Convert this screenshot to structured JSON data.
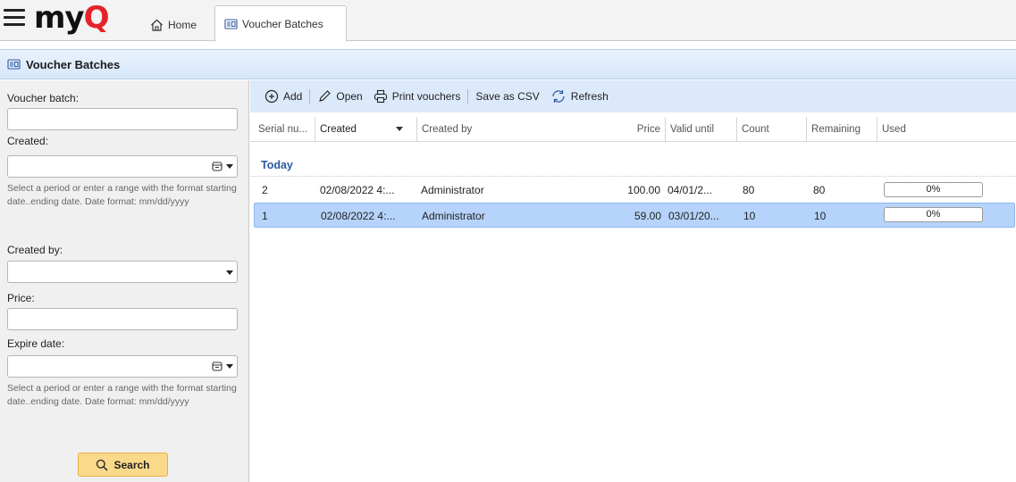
{
  "app": {
    "logo": {
      "part1": "my",
      "part2": "Q"
    },
    "tabs": [
      {
        "label": "Home",
        "icon": "home-icon",
        "active": false
      },
      {
        "label": "Voucher Batches",
        "icon": "voucher-icon",
        "active": true
      }
    ]
  },
  "page": {
    "title": "Voucher Batches",
    "icon": "voucher-icon"
  },
  "filters": {
    "voucher_batch": {
      "label": "Voucher batch:",
      "value": ""
    },
    "created": {
      "label": "Created:",
      "value": "",
      "hint": "Select a period or enter a range with the format starting date..ending date. Date format: mm/dd/yyyy"
    },
    "created_by": {
      "label": "Created by:",
      "value": ""
    },
    "price": {
      "label": "Price:",
      "value": ""
    },
    "expire_date": {
      "label": "Expire date:",
      "value": "",
      "hint": "Select a period or enter a range with the format starting date..ending date. Date format: mm/dd/yyyy"
    },
    "search_label": "Search"
  },
  "toolbar": {
    "add": "Add",
    "open": "Open",
    "print": "Print vouchers",
    "save_csv": "Save as CSV",
    "refresh": "Refresh"
  },
  "table": {
    "columns": {
      "serial": "Serial nu...",
      "created": "Created",
      "created_by": "Created by",
      "price": "Price",
      "valid_until": "Valid until",
      "count": "Count",
      "remaining": "Remaining",
      "used": "Used"
    },
    "sort_column": "created",
    "group_label": "Today",
    "rows": [
      {
        "serial": "2",
        "created": "02/08/2022 4:...",
        "created_by": "Administrator",
        "price": "100.00",
        "valid_until": "04/01/2...",
        "count": "80",
        "remaining": "80",
        "used": "0%",
        "used_fraction": 0,
        "selected": false
      },
      {
        "serial": "1",
        "created": "02/08/2022 4:...",
        "created_by": "Administrator",
        "price": "59.00",
        "valid_until": "03/01/20...",
        "count": "10",
        "remaining": "10",
        "used": "0%",
        "used_fraction": 0,
        "selected": true
      }
    ]
  },
  "colors": {
    "accent": "#e4232b",
    "title_bar": "#d7e7fb",
    "toolbar": "#dce9fb",
    "selected_row": "#b6d4fb",
    "search_button": "#fbd98a",
    "group_text": "#2d5aa0"
  }
}
